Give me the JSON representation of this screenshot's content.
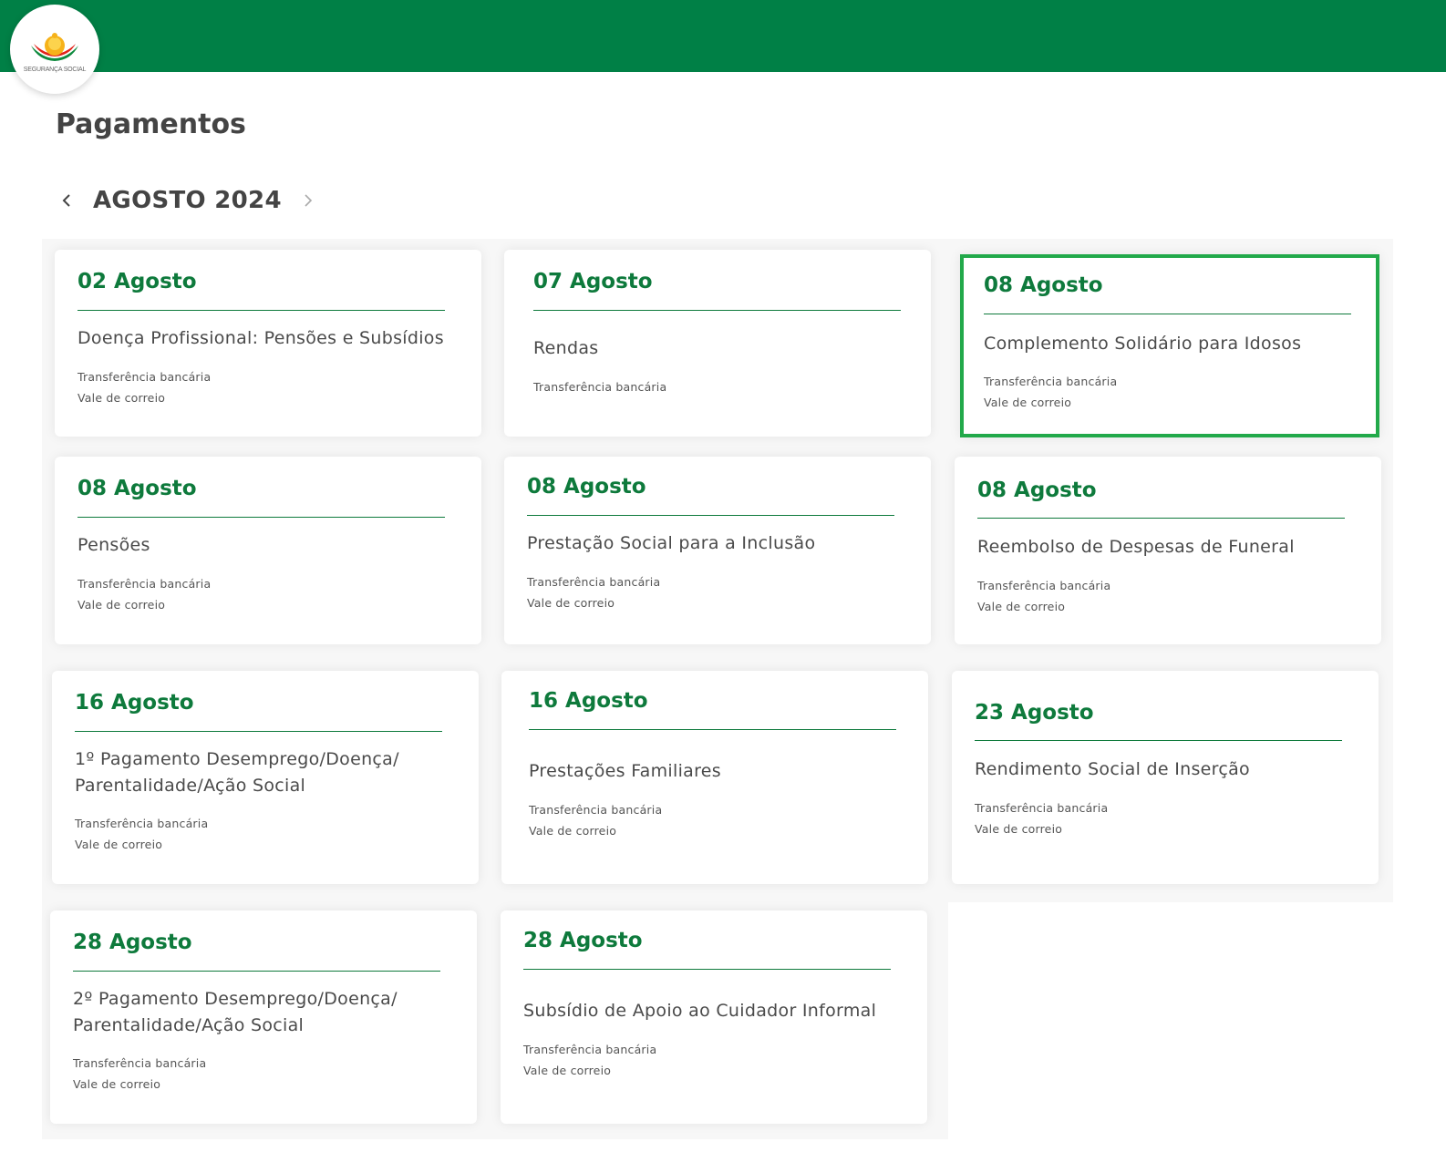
{
  "header": {
    "logo_text": "SEGURANÇA SOCIAL",
    "brand_color": "#008046"
  },
  "page": {
    "title": "Pagamentos"
  },
  "month_nav": {
    "label": "AGOSTO 2024",
    "prev_icon": "chevron-left-icon",
    "next_icon": "chevron-right-icon"
  },
  "cards": [
    {
      "date": "02 Agosto",
      "title": "Doença Profissional: Pensões e Subsídios",
      "methods": [
        "Transferência bancária",
        "Vale de correio"
      ]
    },
    {
      "date": "07 Agosto",
      "title": "Rendas",
      "methods": [
        "Transferência bancária"
      ]
    },
    {
      "date": "08 Agosto",
      "title": "Complemento Solidário para Idosos",
      "methods": [
        "Transferência bancária",
        "Vale de correio"
      ],
      "selected": true
    },
    {
      "date": "08 Agosto",
      "title": "Pensões",
      "methods": [
        "Transferência bancária",
        "Vale de correio"
      ]
    },
    {
      "date": "08 Agosto",
      "title": "Prestação Social para a Inclusão",
      "methods": [
        "Transferência bancária",
        "Vale de correio"
      ]
    },
    {
      "date": "08 Agosto",
      "title": "Reembolso de Despesas de Funeral",
      "methods": [
        "Transferência bancária",
        "Vale de correio"
      ]
    },
    {
      "date": "16 Agosto",
      "title": "1º Pagamento Desemprego/Doença/ Parentalidade/Ação Social",
      "methods": [
        "Transferência bancária",
        "Vale de correio"
      ]
    },
    {
      "date": "16 Agosto",
      "title": "Prestações Familiares",
      "methods": [
        "Transferência bancária",
        "Vale de correio"
      ]
    },
    {
      "date": "23 Agosto",
      "title": "Rendimento Social de Inserção",
      "methods": [
        "Transferência bancária",
        "Vale de correio"
      ]
    },
    {
      "date": "28 Agosto",
      "title": "2º Pagamento Desemprego/Doença/ Parentalidade/Ação Social",
      "methods": [
        "Transferência bancária",
        "Vale de correio"
      ]
    },
    {
      "date": "28 Agosto",
      "title": "Subsídio de Apoio ao Cuidador Informal",
      "methods": [
        "Transferência bancária",
        "Vale de correio"
      ]
    }
  ]
}
